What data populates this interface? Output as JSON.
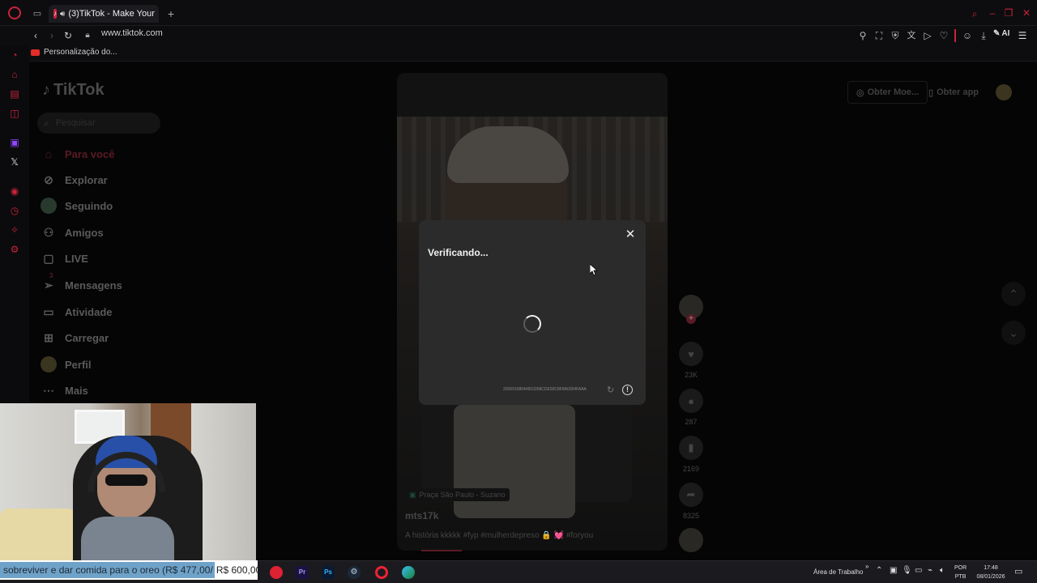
{
  "browser": {
    "tab_title": "(3)TikTok - Make Your",
    "url": "www.tiktok.com",
    "bookmark": "Personalização do...",
    "ai_label": "AI"
  },
  "tiktok": {
    "logo": "TikTok",
    "search_placeholder": "Pesquisar",
    "get_coins": "Obter Moe...",
    "get_app": "Obter app",
    "nav": [
      {
        "label": "Para você",
        "icon": "home-icon"
      },
      {
        "label": "Explorar",
        "icon": "compass-icon"
      },
      {
        "label": "Seguindo",
        "icon": "following-avatar-icon"
      },
      {
        "label": "Amigos",
        "icon": "friends-icon"
      },
      {
        "label": "LIVE",
        "icon": "live-icon"
      },
      {
        "label": "Mensagens",
        "icon": "messages-icon"
      },
      {
        "label": "Atividade",
        "icon": "activity-icon"
      },
      {
        "label": "Carregar",
        "icon": "upload-icon"
      },
      {
        "label": "Perfil",
        "icon": "profile-icon"
      },
      {
        "label": "Mais",
        "icon": "more-icon"
      }
    ],
    "messages_badge": "3",
    "video": {
      "location": "Praça São Paulo - Suzano",
      "author": "mts17k",
      "caption": "A história kkkkk #fyp #mulherdepreso 🔒 💓 #foryou"
    },
    "actions": {
      "likes": "23K",
      "comments": "287",
      "saves": "2169",
      "shares": "8325"
    }
  },
  "modal": {
    "title": "Verificando...",
    "code": "20260108044810358CDE50C8F8A0264FAAA"
  },
  "ticker": {
    "text": "sobreviver e dar comida para o oreo (R$ 477,00/",
    "goal": "R$ 600,00)"
  },
  "taskbar": {
    "desktop_label": "Área de Trabalho",
    "lang_top": "POR",
    "lang_bottom": "PTB",
    "time": "17:48",
    "date": "08/01/2026"
  },
  "colors": {
    "accent": "#c8233b",
    "tiktok_red": "#fe2c55"
  }
}
